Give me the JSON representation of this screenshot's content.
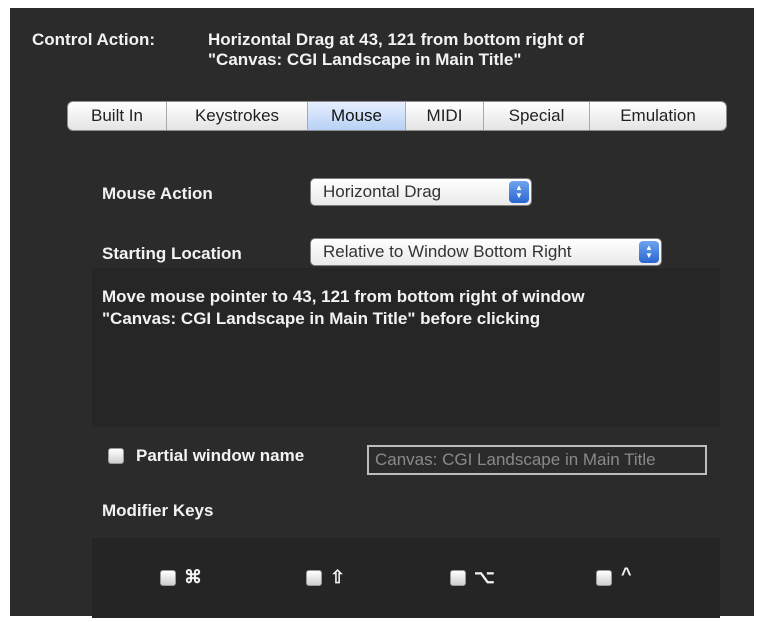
{
  "header": {
    "label": "Control Action:",
    "value": "Horizontal Drag at 43, 121 from bottom right of\n\"Canvas: CGI Landscape in Main Title\""
  },
  "tabs": [
    {
      "label": "Built In"
    },
    {
      "label": "Keystrokes"
    },
    {
      "label": "Mouse",
      "selected": true
    },
    {
      "label": "MIDI"
    },
    {
      "label": "Special"
    },
    {
      "label": "Emulation"
    }
  ],
  "mouse_action": {
    "label": "Mouse Action",
    "value": "Horizontal Drag"
  },
  "starting_location": {
    "label": "Starting Location",
    "value": "Relative to Window Bottom Right"
  },
  "description": "Move mouse pointer to 43, 121 from bottom right of window\n\"Canvas: CGI Landscape in Main Title\" before clicking",
  "partial_window": {
    "label": "Partial window name",
    "checked": false,
    "field_value": "Canvas: CGI Landscape in Main Title"
  },
  "modifier_keys": {
    "label": "Modifier Keys",
    "keys": [
      {
        "symbol": "⌘",
        "icon": "command-icon",
        "checked": false
      },
      {
        "symbol": "⇧",
        "icon": "shift-icon",
        "checked": false
      },
      {
        "symbol": "⌥",
        "icon": "option-icon",
        "checked": false
      },
      {
        "symbol": "^",
        "icon": "control-icon",
        "checked": false
      }
    ]
  },
  "colors": {
    "panel_bg": "#2b2b2b",
    "text": "#f2f2f2",
    "selected_tab": "#b8d1f5",
    "popup_arrow": "#2a66d0"
  }
}
